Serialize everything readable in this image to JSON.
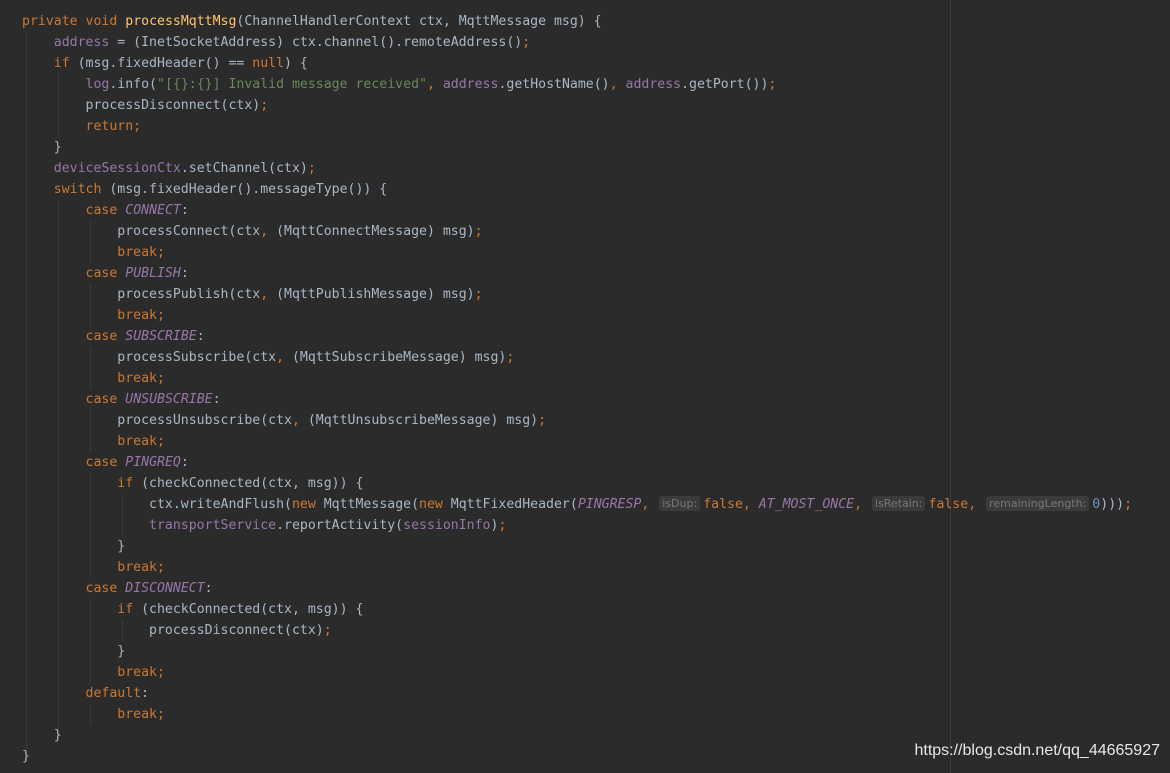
{
  "editor": {
    "theme_colors": {
      "background": "#2b2b2b",
      "default_text": "#a9b7c6",
      "keyword": "#cc7832",
      "method_declaration": "#ffc66d",
      "field": "#9876aa",
      "string": "#6a8759",
      "number": "#6897bb"
    },
    "tokens": {
      "private": "private",
      "void": "void",
      "method_name": "processMqttMsg",
      "signature_params": "(ChannelHandlerContext ctx, MqttMessage msg) {",
      "address": "address",
      "l2_rest": " = (InetSocketAddress) ctx.channel().remoteAddress()",
      "semi": ";",
      "if": "if",
      "l3_cond": " (msg.fixedHeader() == ",
      "null": "null",
      "l3_end": ") {",
      "log": "log",
      "info_call": ".info(",
      "log_msg": "\"[{}:{}] Invalid message received\"",
      "comma": ",",
      "get_host": ".getHostName()",
      "get_port": ".getPort())",
      "process_disconnect_ctx": "processDisconnect(ctx)",
      "return": "return",
      "close_brace": "}",
      "device_session_ctx": "deviceSessionCtx",
      "set_channel": ".setChannel(ctx)",
      "switch": "switch",
      "switch_cond": " (msg.fixedHeader().messageType()) {",
      "case": "case",
      "colon": ":",
      "break": "break",
      "default": "default",
      "process_connect": "processConnect(ctx",
      "cast_connect": " (MqttConnectMessage) msg)",
      "process_publish": "processPublish(ctx",
      "cast_publish": " (MqttPublishMessage) msg)",
      "process_subscribe": "processSubscribe(ctx",
      "cast_subscribe": " (MqttSubscribeMessage) msg)",
      "process_unsubscribe": "processUnsubscribe(ctx",
      "cast_unsubscribe": " (MqttUnsubscribeMessage) msg)",
      "check_connected": " (checkConnected(ctx, msg)) {",
      "write_flush": "ctx.writeAndFlush(",
      "new": "new",
      "mqtt_message_open": " MqttMessage(",
      "mqtt_fixed_header_open": " MqttFixedHeader(",
      "false": "false",
      "zero": "0",
      "closing_parens": ")))",
      "transport_service": "transportService",
      "report_activity": ".reportActivity(",
      "session_info": "sessionInfo",
      "close_paren": ")"
    },
    "constants": {
      "connect": "CONNECT",
      "publish": "PUBLISH",
      "subscribe": "SUBSCRIBE",
      "unsubscribe": "UNSUBSCRIBE",
      "pingreq": "PINGREQ",
      "disconnect": "DISCONNECT",
      "pingresp": "PINGRESP",
      "at_most_once": "AT_MOST_ONCE"
    },
    "inlay_hints": {
      "is_dup": "isDup:",
      "is_retain": "isRetain:",
      "remaining_length": "remainingLength:"
    }
  },
  "watermark": {
    "text": "https://blog.csdn.net/qq_44665927"
  }
}
